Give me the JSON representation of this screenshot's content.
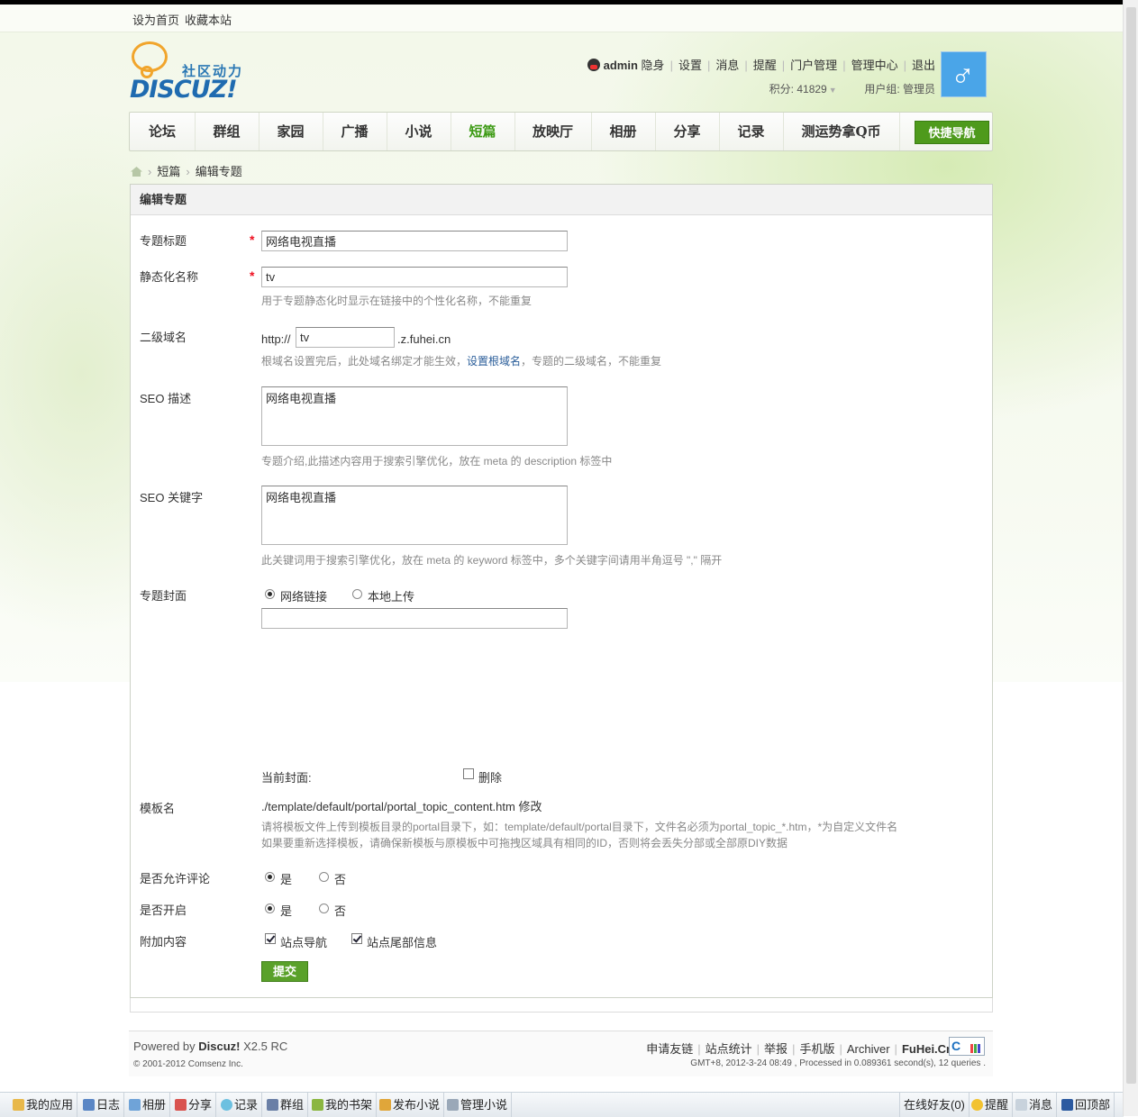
{
  "top_links": [
    "设为首页",
    "收藏本站"
  ],
  "logo": {
    "cn": "社区动力",
    "en": "DISCUZ!"
  },
  "user": {
    "name": "admin",
    "links": [
      "隐身",
      "设置",
      "消息",
      "提醒",
      "门户管理",
      "管理中心",
      "退出"
    ],
    "points": "积分: 41829",
    "group": "用户组: 管理员",
    "avatar_icon": "male-symbol-icon"
  },
  "nav": {
    "items": [
      "论坛",
      "群组",
      "家园",
      "广播",
      "小说",
      "短篇",
      "放映厅",
      "相册",
      "分享",
      "记录",
      "测运势拿Q币"
    ],
    "active": "短篇",
    "quick_nav": "快捷导航"
  },
  "breadcrumb": [
    "短篇",
    "编辑专题"
  ],
  "panel_title": "编辑专题",
  "form": {
    "title_label": "专题标题",
    "title_value": "网络电视直播",
    "static_label": "静态化名称",
    "static_value": "tv",
    "static_hint": "用于专题静态化时显示在链接中的个性化名称，不能重复",
    "domain_label": "二级域名",
    "domain_prefix": "http://",
    "domain_value": "tv",
    "domain_suffix": ".z.fuhei.cn",
    "domain_hint_pre": "根域名设置完后，此处域名绑定才能生效，",
    "domain_hint_link": "设置根域名",
    "domain_hint_post": "，专题的二级域名，不能重复",
    "seo_desc_label": "SEO 描述",
    "seo_desc_value": "网络电视直播",
    "seo_desc_hint": "专题介绍,此描述内容用于搜索引擎优化，放在 meta 的 description 标签中",
    "seo_kw_label": "SEO 关键字",
    "seo_kw_value": "网络电视直播",
    "seo_kw_hint": "此关键词用于搜索引擎优化，放在 meta 的 keyword 标签中，多个关键字间请用半角逗号 \",\" 隔开",
    "cover_label": "专题封面",
    "cover_opt_net": "网络链接",
    "cover_opt_local": "本地上传",
    "cover_url": "",
    "current_cover": "当前封面:",
    "delete_label": "删除",
    "template_label": "模板名",
    "template_value": "./template/default/portal/portal_topic_content.htm",
    "template_edit": "修改",
    "template_hint1": "请将模板文件上传到模板目录的portal目录下，如：template/default/portal目录下，文件名必须为portal_topic_*.htm，*为自定义文件名",
    "template_hint2": "如果要重新选择模板，请确保新模板与原模板中可拖拽区域具有相同的ID，否则将会丢失分部或全部原DIY数据",
    "allow_comment_label": "是否允许评论",
    "open_label": "是否开启",
    "yes": "是",
    "no": "否",
    "extra_label": "附加内容",
    "extra_nav": "站点导航",
    "extra_footer": "站点尾部信息",
    "submit": "提交"
  },
  "footer": {
    "powered_prefix": "Powered by",
    "powered_brand": "Discuz!",
    "powered_version": "X2.5 RC",
    "copyright": "© 2001-2012 Comsenz Inc.",
    "links": [
      "申请友链",
      "站点统计",
      "举报",
      "手机版",
      "Archiver"
    ],
    "site": "FuHei.Cn",
    "stats": "GMT+8, 2012-3-24 08:49 , Processed in 0.089361 second(s), 12 queries ."
  },
  "appbar": {
    "left": [
      "我的应用",
      "日志",
      "相册",
      "分享",
      "记录",
      "群组",
      "我的书架",
      "发布小说",
      "管理小说"
    ],
    "right": [
      "在线好友(0)",
      "提醒",
      "消息",
      "回顶部"
    ]
  }
}
